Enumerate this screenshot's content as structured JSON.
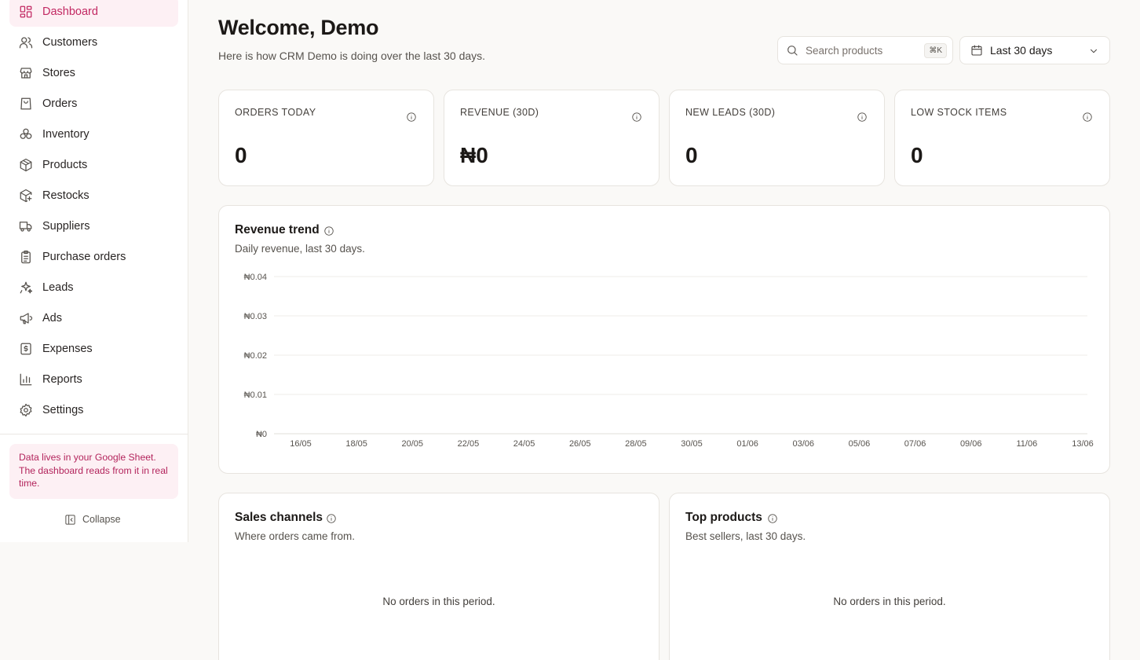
{
  "sidebar": {
    "items": [
      {
        "label": "Dashboard",
        "icon": "dashboard-icon",
        "active": true
      },
      {
        "label": "Customers",
        "icon": "users-icon"
      },
      {
        "label": "Stores",
        "icon": "store-icon"
      },
      {
        "label": "Orders",
        "icon": "shopping-bag-icon"
      },
      {
        "label": "Inventory",
        "icon": "boxes-icon"
      },
      {
        "label": "Products",
        "icon": "package-icon"
      },
      {
        "label": "Restocks",
        "icon": "package-plus-icon"
      },
      {
        "label": "Suppliers",
        "icon": "truck-icon"
      },
      {
        "label": "Purchase orders",
        "icon": "clipboard-list-icon"
      },
      {
        "label": "Leads",
        "icon": "sparkles-icon"
      },
      {
        "label": "Ads",
        "icon": "megaphone-icon"
      },
      {
        "label": "Expenses",
        "icon": "receipt-icon"
      },
      {
        "label": "Reports",
        "icon": "bar-chart-icon"
      },
      {
        "label": "Settings",
        "icon": "gear-icon"
      }
    ],
    "note": "Data lives in your Google Sheet. The dashboard reads from it in real time.",
    "collapse_label": "Collapse"
  },
  "header": {
    "title": "Welcome, Demo",
    "subtitle": "Here is how CRM Demo is doing over the last 30 days.",
    "search_placeholder": "Search products",
    "search_shortcut": "⌘K",
    "date_range": "Last 30 days"
  },
  "kpis": [
    {
      "label": "ORDERS TODAY",
      "value": "0"
    },
    {
      "label": "REVENUE (30D)",
      "value": "₦0"
    },
    {
      "label": "NEW LEADS (30D)",
      "value": "0"
    },
    {
      "label": "LOW STOCK ITEMS",
      "value": "0"
    }
  ],
  "revenue_card": {
    "title": "Revenue trend",
    "subtitle": "Daily revenue, last 30 days."
  },
  "sales_channels": {
    "title": "Sales channels",
    "subtitle": "Where orders came from.",
    "empty": "No orders in this period."
  },
  "top_products": {
    "title": "Top products",
    "subtitle": "Best sellers, last 30 days.",
    "empty": "No orders in this period."
  },
  "colors": {
    "accent": "#c22862",
    "accent_bg": "#fdf0f4",
    "page_bg": "#faf9f7",
    "border": "#e7e4df"
  },
  "chart_data": {
    "type": "line",
    "title": "Revenue trend",
    "subtitle": "Daily revenue, last 30 days.",
    "x_ticks": [
      "16/05",
      "18/05",
      "20/05",
      "22/05",
      "24/05",
      "26/05",
      "28/05",
      "30/05",
      "01/06",
      "03/06",
      "05/06",
      "07/06",
      "09/06",
      "11/06",
      "13/06"
    ],
    "y_ticks": [
      "₦0.04",
      "₦0.03",
      "₦0.02",
      "₦0.01",
      "₦0"
    ],
    "ylim": [
      0,
      0.04
    ],
    "grid": true,
    "series": [
      {
        "values": [
          0,
          0,
          0,
          0,
          0,
          0,
          0,
          0,
          0,
          0,
          0,
          0,
          0,
          0,
          0
        ]
      }
    ]
  }
}
